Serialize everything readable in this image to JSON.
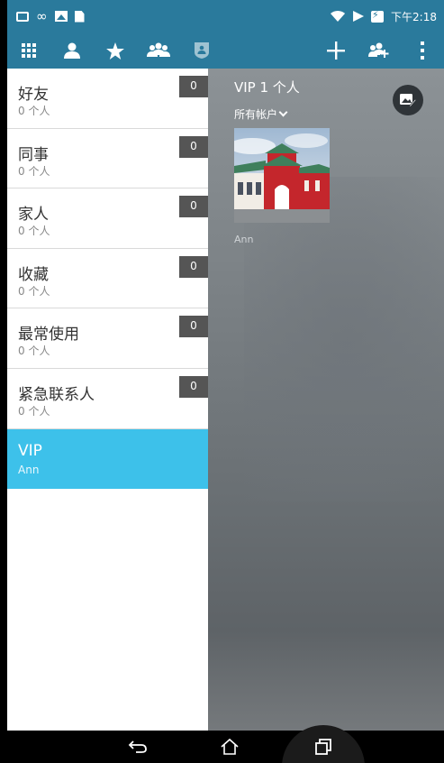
{
  "status_bar": {
    "time": "下午2:18"
  },
  "action_bar": {
    "icons": [
      "apps-grid-icon",
      "person-icon",
      "star-icon",
      "groups-icon",
      "shield-icon",
      "add-icon",
      "add-group-icon",
      "more-vert-icon"
    ]
  },
  "groups": [
    {
      "name": "好友",
      "count": "0 个人",
      "badge": "0"
    },
    {
      "name": "同事",
      "count": "0 个人",
      "badge": "0"
    },
    {
      "name": "家人",
      "count": "0 个人",
      "badge": "0"
    },
    {
      "name": "收藏",
      "count": "0 个人",
      "badge": "0"
    },
    {
      "name": "最常使用",
      "count": "0 个人",
      "badge": "0"
    },
    {
      "name": "紧急联系人",
      "count": "0 个人",
      "badge": "0"
    },
    {
      "name": "VIP",
      "count": "Ann"
    }
  ],
  "detail": {
    "title": "VIP 1 个人",
    "filter": "所有帐户",
    "contact_name": "Ann"
  },
  "colors": {
    "primary": "#2a7a9c",
    "selected": "#3dc1ea",
    "badge": "#555555"
  }
}
